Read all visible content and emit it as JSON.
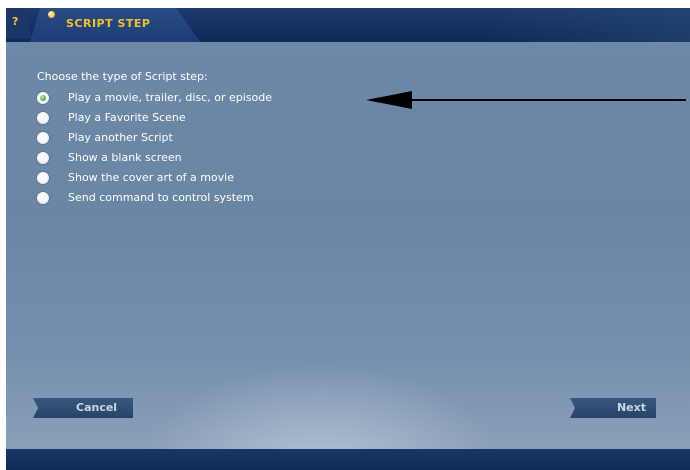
{
  "header": {
    "help_glyph": "?",
    "tab_title": "SCRIPT STEP"
  },
  "main": {
    "prompt": "Choose the type of Script step:",
    "options": [
      {
        "label": "Play a movie, trailer, disc, or episode",
        "checked": true
      },
      {
        "label": "Play a Favorite Scene",
        "checked": false
      },
      {
        "label": "Play another Script",
        "checked": false
      },
      {
        "label": "Show a blank screen",
        "checked": false
      },
      {
        "label": "Show the cover art of a movie",
        "checked": false
      },
      {
        "label": "Send command to control system",
        "checked": false
      }
    ]
  },
  "footer": {
    "cancel_label": "Cancel",
    "next_label": "Next"
  },
  "colors": {
    "panel": "#6e88a8",
    "header": "#13305f",
    "tab_text": "#f0c030",
    "selected_radio": "#3ea43a"
  },
  "icons": {
    "help": "help-icon",
    "tab_marker": "dot-icon",
    "annotation": "arrow-icon"
  }
}
